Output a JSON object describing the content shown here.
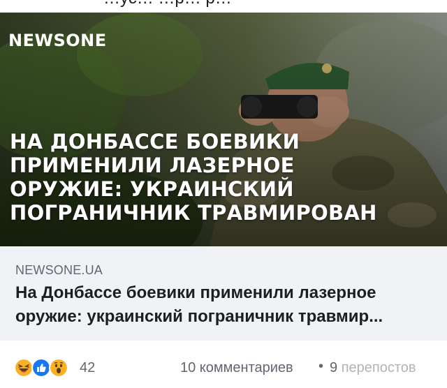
{
  "post": {
    "top_text_fragment": "…ус… …р… р…",
    "image": {
      "brand": "NEWSONE",
      "headline_lines": [
        "НА ДОНБАССЕ БОЕВИКИ",
        "ПРИМЕНИЛИ ЛАЗЕРНОЕ",
        "ОРУЖИЕ: УКРАИНСКИЙ",
        "ПОГРАНИЧНИК ТРАВМИРОВАН"
      ]
    },
    "link": {
      "domain": "NEWSONE.UA",
      "title_lines": [
        "На Донбассе боевики применили лазерное",
        "оружие: украинский пограничник травмир..."
      ]
    },
    "footer": {
      "reaction_icons": [
        "haha-icon",
        "like-icon",
        "wow-icon"
      ],
      "reaction_count": "42",
      "comments": "10 комментариев",
      "separator": "•",
      "shares_head": "9 ",
      "shares_tail": "перепостов"
    }
  }
}
